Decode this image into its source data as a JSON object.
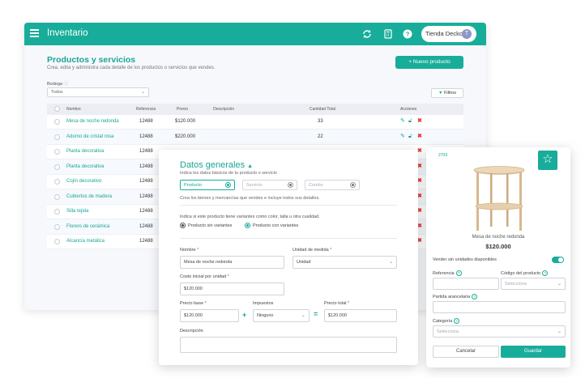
{
  "app": {
    "title": "Inventario",
    "store_name": "Tienda Decko",
    "avatar_initial": "T",
    "accent_color": "#18ad9a",
    "icons": [
      "menu-icon",
      "sync-icon",
      "calculator-icon",
      "help-icon"
    ]
  },
  "page": {
    "title": "Productos y servicios",
    "subtitle": "Crea, edita y administra cada detalle de los productos o servicios que vendes.",
    "new_button": "+ Nuevo producto",
    "warehouse_label": "Bodega",
    "warehouse_value": "Todos",
    "filter_button": "Filtros"
  },
  "table": {
    "headers": [
      "Nombre",
      "Referencia",
      "Precio",
      "Descripción",
      "Cantidad Total",
      "Acciones"
    ],
    "rows": [
      {
        "name": "Mesa de noche redonda",
        "ref": "12488",
        "price": "$120.000",
        "qty": "33"
      },
      {
        "name": "Adorno de cristal rosa",
        "ref": "12488",
        "price": "$220.000",
        "qty": "22"
      },
      {
        "name": "Planta decorativa",
        "ref": "12488",
        "price": "",
        "qty": ""
      },
      {
        "name": "Planta decorativa",
        "ref": "12488",
        "price": "",
        "qty": ""
      },
      {
        "name": "Cojín decorativo",
        "ref": "12488",
        "price": "",
        "qty": ""
      },
      {
        "name": "Cubiertos de madera",
        "ref": "12488",
        "price": "",
        "qty": ""
      },
      {
        "name": "Silla tejida",
        "ref": "12488",
        "price": "",
        "qty": ""
      },
      {
        "name": "Florero de cerámica",
        "ref": "12488",
        "price": "",
        "qty": ""
      },
      {
        "name": "Alcancía metálica",
        "ref": "12488",
        "price": "",
        "qty": ""
      }
    ]
  },
  "general": {
    "title": "Datos generales",
    "subtitle": "Indica los datos básicos de tu producto o servicio",
    "types": [
      "Producto",
      "Servicio",
      "Combo"
    ],
    "types_help": "Crea los bienes y mercancías que vendes e incluye todos sus detalles.",
    "variants_question": "Indica si este producto tiene variantes como color, talla u otra cualidad.",
    "variant_options": [
      "Producto sin variantes",
      "Producto con variantes"
    ],
    "name_label": "Nombre",
    "name_value": "Mesa de noche redonda",
    "unit_label": "Unidad de medida",
    "unit_value": "Unidad",
    "cost_label": "Costo inicial por unidad",
    "cost_value": "$120.000",
    "base_price_label": "Precio base",
    "base_price_value": "$120.000",
    "tax_label": "Impuestos",
    "tax_value": "Ninguno",
    "total_price_label": "Precio total",
    "total_price_value": "$120.000",
    "description_label": "Descripción",
    "required_mark": "*"
  },
  "card": {
    "code": "2709",
    "product_name": "Mesa de noche redonda",
    "price": "$120.000",
    "sell_without_units": "Vender sin unidades disponibles",
    "reference_label": "Referencia",
    "product_code_label": "Código del producto",
    "product_code_placeholder": "Selecciona",
    "tariff_label": "Partida arancelaria",
    "category_label": "Categoría",
    "category_placeholder": "Selecciona",
    "cancel": "Cancelar",
    "save": "Guardar"
  }
}
